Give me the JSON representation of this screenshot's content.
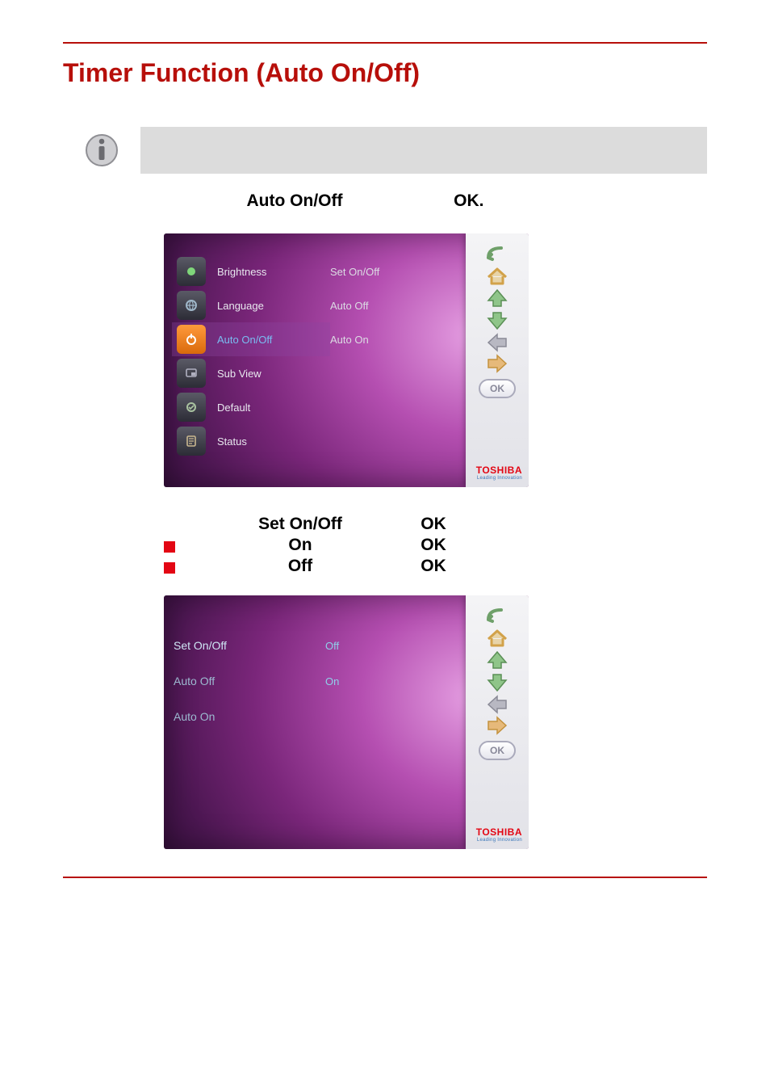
{
  "page": {
    "title": "Timer Function (Auto On/Off)"
  },
  "step1": {
    "bold_a": "Auto On/Off",
    "bold_b": "OK."
  },
  "tv1": {
    "menu": [
      "Brightness",
      "Language",
      "Auto On/Off",
      "Sub View",
      "Default",
      "Status"
    ],
    "submenu": [
      "Set On/Off",
      "Auto Off",
      "Auto On"
    ],
    "brand": "TOSHIBA",
    "tagline": "Leading Innovation",
    "ok_label": "OK"
  },
  "step2": {
    "header_a": "Set On/Off",
    "header_b": "OK",
    "rows": [
      {
        "label": "On",
        "action": "OK"
      },
      {
        "label": "Off",
        "action": "OK"
      }
    ]
  },
  "tv2": {
    "left": [
      "Set On/Off",
      "Auto Off",
      "Auto On"
    ],
    "right": [
      "Off",
      "On"
    ],
    "brand": "TOSHIBA",
    "tagline": "Leading Innovation",
    "ok_label": "OK"
  },
  "icons": {
    "info": "info-icon",
    "power": "power-icon",
    "back": "back-arrow-icon",
    "home": "home-icon",
    "up": "arrow-up-icon",
    "down": "arrow-down-icon",
    "left": "arrow-left-icon",
    "right": "arrow-right-icon"
  }
}
